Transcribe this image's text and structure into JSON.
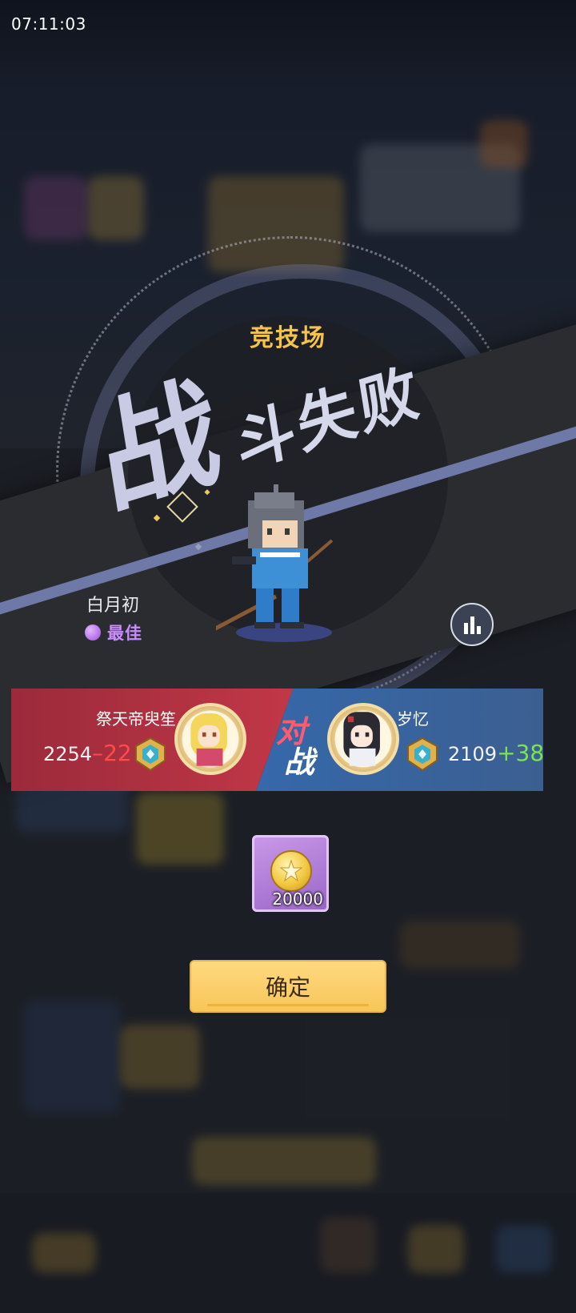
{
  "status_bar": {
    "time": "07:11:03"
  },
  "arena": {
    "title": "竞技场",
    "result_main": "战",
    "result_rest": "斗失败"
  },
  "player": {
    "name": "白月初",
    "best_label": "最佳"
  },
  "versus": {
    "vs_char1": "对",
    "vs_char2": "战",
    "left": {
      "name": "祭天帝臾笙",
      "score": "2254",
      "sign": "–",
      "delta": "22"
    },
    "right": {
      "name": "岁忆",
      "score": "2109",
      "sign": "+",
      "delta": "38"
    }
  },
  "reward": {
    "icon": "gold-coin-icon",
    "count": "20000"
  },
  "confirm_label": "确定",
  "colors": {
    "title_gold": "#f5c24d",
    "best_purple": "#c98cff",
    "loss_red": "#ff4b4b",
    "gain_green": "#7be25a",
    "button_yellow": "#f8c659"
  }
}
